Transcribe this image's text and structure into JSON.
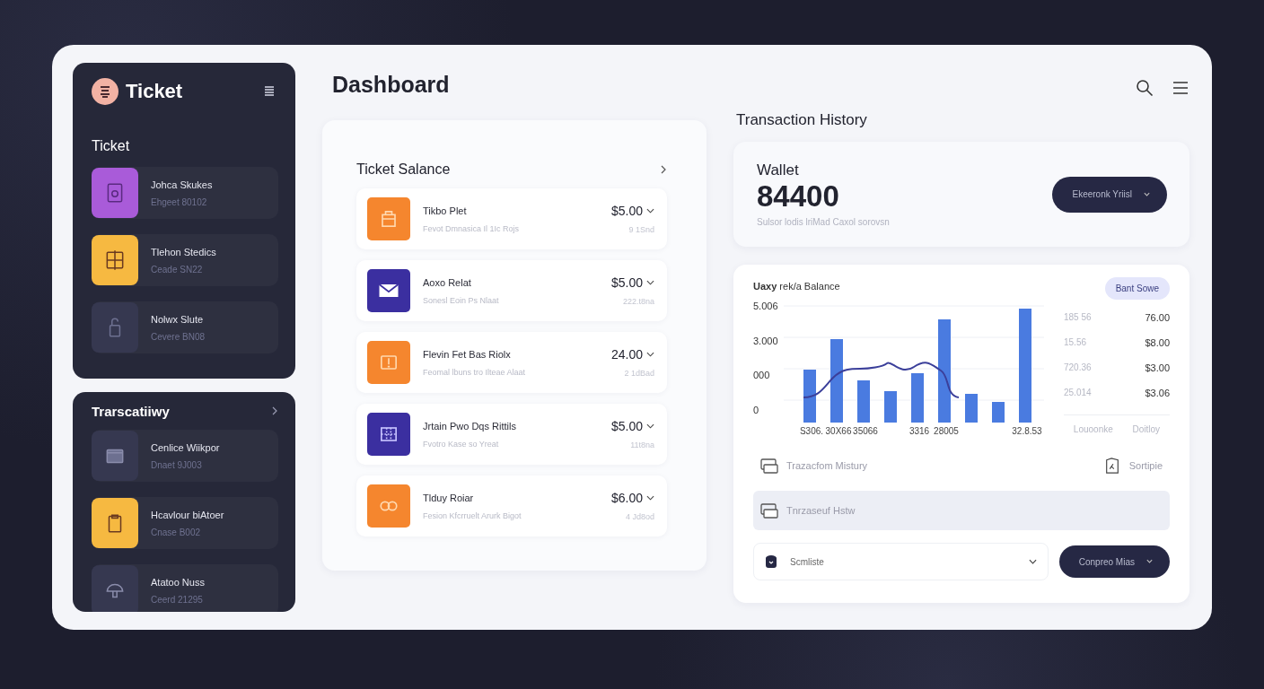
{
  "brand": {
    "name": "Ticket"
  },
  "sidebar": {
    "title": "Ticket",
    "items": [
      {
        "title": "Johca Skukes",
        "subtitle": "Ehgeet 80102",
        "color": "#a95bd9",
        "kind": "tablet"
      },
      {
        "title": "Tlehon Stedics",
        "subtitle": "Ceade SN22",
        "color": "#f6b941",
        "kind": "window"
      },
      {
        "title": "Nolwx Slute",
        "subtitle": "Cevere BN08",
        "color": "#363850",
        "kind": "lock"
      }
    ]
  },
  "transactions_panel": {
    "title": "Trarscatiiwy",
    "items": [
      {
        "title": "Cenlice Wiikpor",
        "subtitle": "Dnaet 9J003",
        "color": "#363850",
        "kind": "folder"
      },
      {
        "title": "Hcavlour biAtoer",
        "subtitle": "Cnase B002",
        "color": "#f6b941",
        "kind": "clipboard"
      },
      {
        "title": "Atatoo Nuss",
        "subtitle": "Ceerd 21295",
        "color": "#363850",
        "kind": "mushroom"
      }
    ]
  },
  "page_title": "Dashboard",
  "ticket_balance": {
    "title": "Ticket Salance",
    "rows": [
      {
        "title": "Tikbo Plet",
        "subtitle": "Fevot Dmnasica Il 1Ic Rojs",
        "amount": "$5.00",
        "note": "9 1Snd",
        "color": "#f5862e",
        "kind": "bag"
      },
      {
        "title": "Aoxo Relat",
        "subtitle": "Sonesl Eoin Ps Nlaat",
        "amount": "$5.00",
        "note": "222.t8na",
        "color": "#3b2fa0",
        "kind": "mail"
      },
      {
        "title": "Flevin Fet Bas Riolx",
        "subtitle": "Feomal lbuns tro Ilteae Alaat",
        "amount": "24.00",
        "note": "2 1dBad",
        "color": "#f5862e",
        "kind": "frame"
      },
      {
        "title": "Jrtain Pwo Dqs Rittils",
        "subtitle": "Fvotro Kase so Yreat",
        "amount": "$5.00",
        "note": "11t8na",
        "color": "#3b2fa0",
        "kind": "grid"
      },
      {
        "title": "Tlduy Roiar",
        "subtitle": "Fesion Kfcrruelt Arurk Bigot",
        "amount": "$6.00",
        "note": "4 Jd8od",
        "color": "#f5862e",
        "kind": "infinity"
      }
    ]
  },
  "transaction_history": {
    "title": "Transaction History",
    "wallet": {
      "label": "Wallet",
      "amount": "84400",
      "caption": "Sulsor lodis lriMad Caxol sorovsn",
      "button": "Ekeeronk Yriisl"
    },
    "chart": {
      "title": "**Uaxy** rek/a Balance",
      "badge": "Bant Sowe",
      "y_labels": [
        "5.006",
        "3.000",
        "000",
        "0"
      ],
      "x_labels": [
        "S306.",
        "30X66",
        "35066",
        "3316",
        "28005",
        "32.8.53"
      ],
      "side_rows": [
        {
          "label": "185 56",
          "value": "76.00"
        },
        {
          "label": "15.56",
          "value": "$8.00"
        },
        {
          "label": "720.36",
          "value": "$3.00"
        },
        {
          "label": "25.014",
          "value": "$3.06"
        }
      ],
      "footer": [
        "Louoonke",
        "Doitloy"
      ]
    },
    "history_rows": [
      {
        "label": "Trazacfom Mistury",
        "action": "Sortipie",
        "selected": false
      },
      {
        "label": "Tnrzaseuf Hstw",
        "selected": true
      }
    ],
    "select": {
      "value": "Scmliste"
    },
    "confirm_button": "Conpreo Mias"
  }
}
